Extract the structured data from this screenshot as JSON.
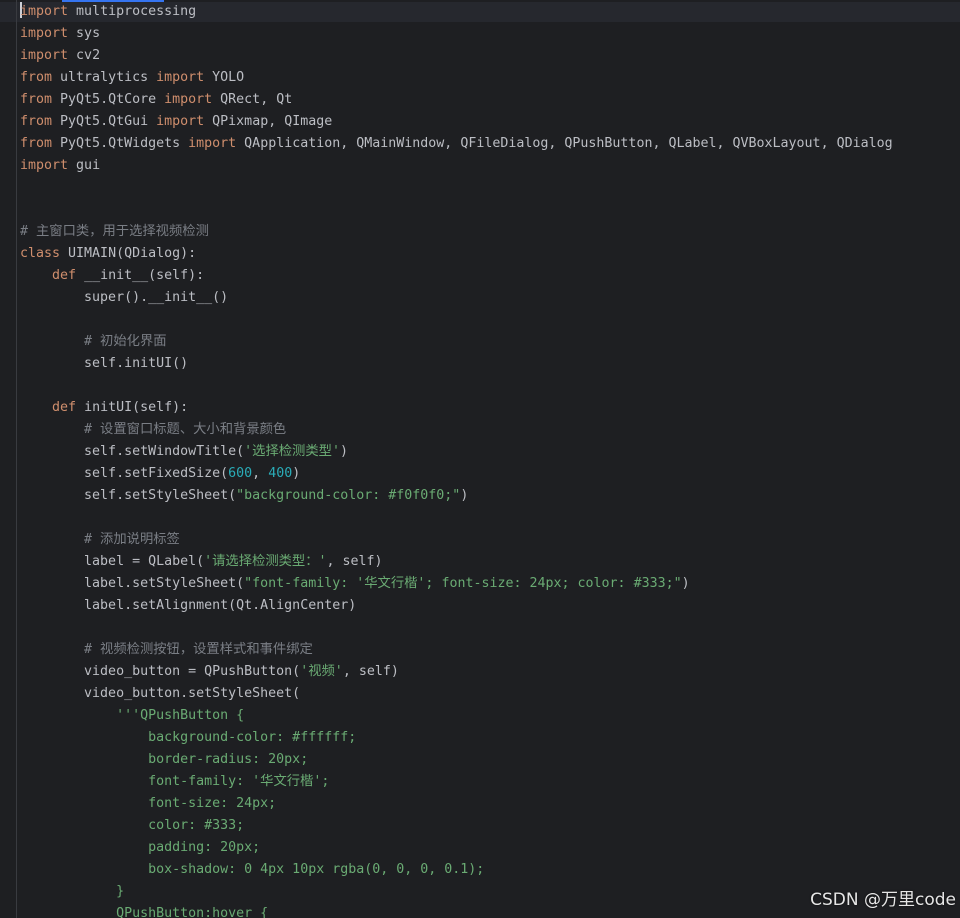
{
  "editor": {
    "colors": {
      "background": "#1e1f22",
      "keyword": "#cf8e6d",
      "string": "#6aab73",
      "number": "#2aacb8",
      "comment": "#7a7e85",
      "text": "#bcbec4",
      "tab_accent": "#3574f0"
    },
    "lines": [
      [
        {
          "t": "import",
          "c": "kw"
        },
        {
          "t": " multiprocessing",
          "c": "plain"
        }
      ],
      [
        {
          "t": "import",
          "c": "kw"
        },
        {
          "t": " sys",
          "c": "plain"
        }
      ],
      [
        {
          "t": "import",
          "c": "kw"
        },
        {
          "t": " cv2",
          "c": "plain"
        }
      ],
      [
        {
          "t": "from",
          "c": "kw"
        },
        {
          "t": " ultralytics ",
          "c": "plain"
        },
        {
          "t": "import",
          "c": "kw"
        },
        {
          "t": " YOLO",
          "c": "plain"
        }
      ],
      [
        {
          "t": "from",
          "c": "kw"
        },
        {
          "t": " PyQt5.QtCore ",
          "c": "plain"
        },
        {
          "t": "import",
          "c": "kw"
        },
        {
          "t": " QRect, Qt",
          "c": "plain"
        }
      ],
      [
        {
          "t": "from",
          "c": "kw"
        },
        {
          "t": " PyQt5.QtGui ",
          "c": "plain"
        },
        {
          "t": "import",
          "c": "kw"
        },
        {
          "t": " QPixmap, QImage",
          "c": "plain"
        }
      ],
      [
        {
          "t": "from",
          "c": "kw"
        },
        {
          "t": " PyQt5.QtWidgets ",
          "c": "plain"
        },
        {
          "t": "import",
          "c": "kw"
        },
        {
          "t": " QApplication, QMainWindow, QFileDialog, QPushButton, QLabel, QVBoxLayout, QDialog",
          "c": "plain"
        }
      ],
      [
        {
          "t": "import",
          "c": "kw"
        },
        {
          "t": " gui",
          "c": "plain"
        }
      ],
      [],
      [],
      [
        {
          "t": "# 主窗口类，用于选择视频检测",
          "c": "cmt"
        }
      ],
      [
        {
          "t": "class",
          "c": "kw"
        },
        {
          "t": " UIMAIN(QDialog):",
          "c": "plain"
        }
      ],
      [
        {
          "t": "    ",
          "c": "plain"
        },
        {
          "t": "def",
          "c": "kw"
        },
        {
          "t": " __init__(self):",
          "c": "plain"
        }
      ],
      [
        {
          "t": "        super().__init__()",
          "c": "plain"
        }
      ],
      [],
      [
        {
          "t": "        ",
          "c": "plain"
        },
        {
          "t": "# 初始化界面",
          "c": "cmt"
        }
      ],
      [
        {
          "t": "        self.initUI()",
          "c": "plain"
        }
      ],
      [],
      [
        {
          "t": "    ",
          "c": "plain"
        },
        {
          "t": "def",
          "c": "kw"
        },
        {
          "t": " initUI(self):",
          "c": "plain"
        }
      ],
      [
        {
          "t": "        ",
          "c": "plain"
        },
        {
          "t": "# 设置窗口标题、大小和背景颜色",
          "c": "cmt"
        }
      ],
      [
        {
          "t": "        self.setWindowTitle(",
          "c": "plain"
        },
        {
          "t": "'选择检测类型'",
          "c": "str"
        },
        {
          "t": ")",
          "c": "plain"
        }
      ],
      [
        {
          "t": "        self.setFixedSize(",
          "c": "plain"
        },
        {
          "t": "600",
          "c": "num"
        },
        {
          "t": ", ",
          "c": "plain"
        },
        {
          "t": "400",
          "c": "num"
        },
        {
          "t": ")",
          "c": "plain"
        }
      ],
      [
        {
          "t": "        self.setStyleSheet(",
          "c": "plain"
        },
        {
          "t": "\"background-color: #f0f0f0;\"",
          "c": "str"
        },
        {
          "t": ")",
          "c": "plain"
        }
      ],
      [],
      [
        {
          "t": "        ",
          "c": "plain"
        },
        {
          "t": "# 添加说明标签",
          "c": "cmt"
        }
      ],
      [
        {
          "t": "        label = QLabel(",
          "c": "plain"
        },
        {
          "t": "'请选择检测类型：'",
          "c": "str"
        },
        {
          "t": ", self)",
          "c": "plain"
        }
      ],
      [
        {
          "t": "        label.setStyleSheet(",
          "c": "plain"
        },
        {
          "t": "\"font-family: '华文行楷'; font-size: 24px; color: #333;\"",
          "c": "str"
        },
        {
          "t": ")",
          "c": "plain"
        }
      ],
      [
        {
          "t": "        label.setAlignment(Qt.AlignCenter)",
          "c": "plain"
        }
      ],
      [],
      [
        {
          "t": "        ",
          "c": "plain"
        },
        {
          "t": "# 视频检测按钮，设置样式和事件绑定",
          "c": "cmt"
        }
      ],
      [
        {
          "t": "        video_button = QPushButton(",
          "c": "plain"
        },
        {
          "t": "'视频'",
          "c": "str"
        },
        {
          "t": ", self)",
          "c": "plain"
        }
      ],
      [
        {
          "t": "        video_button.setStyleSheet(",
          "c": "plain"
        }
      ],
      [
        {
          "t": "            ",
          "c": "plain"
        },
        {
          "t": "'''QPushButton {",
          "c": "str"
        }
      ],
      [
        {
          "t": "                background-color: #ffffff;",
          "c": "str"
        }
      ],
      [
        {
          "t": "                border-radius: 20px;",
          "c": "str"
        }
      ],
      [
        {
          "t": "                font-family: '华文行楷';",
          "c": "str"
        }
      ],
      [
        {
          "t": "                font-size: 24px;",
          "c": "str"
        }
      ],
      [
        {
          "t": "                color: #333;",
          "c": "str"
        }
      ],
      [
        {
          "t": "                padding: 20px;",
          "c": "str"
        }
      ],
      [
        {
          "t": "                box-shadow: 0 4px 10px rgba(0, 0, 0, 0.1);",
          "c": "str"
        }
      ],
      [
        {
          "t": "            }",
          "c": "str"
        }
      ],
      [
        {
          "t": "            QPushButton:hover {",
          "c": "str"
        }
      ]
    ]
  },
  "watermark": {
    "text": "CSDN @万里code"
  }
}
